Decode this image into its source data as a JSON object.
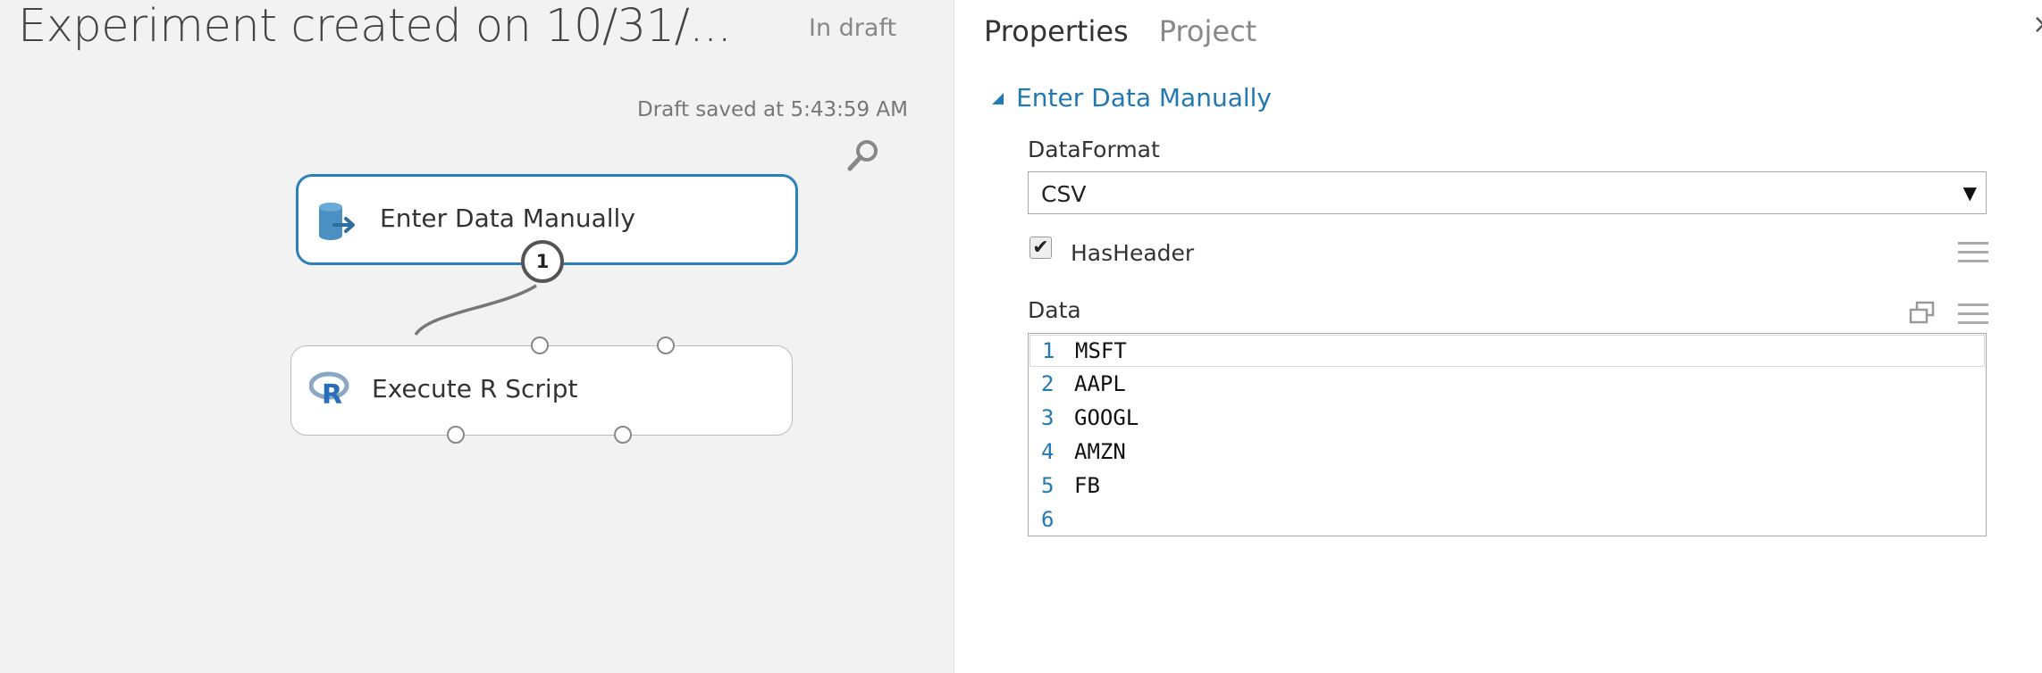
{
  "experiment": {
    "title": "Experiment created on 10/31/...",
    "status": "In draft",
    "draft_saved": "Draft saved at 5:43:59 AM"
  },
  "modules": [
    {
      "label": "Enter Data Manually",
      "icon": "dataset-input-icon",
      "selected": true,
      "output_port_label": "1"
    },
    {
      "label": "Execute R Script",
      "icon": "r-logo-icon",
      "selected": false
    }
  ],
  "panel": {
    "tabs": [
      {
        "label": "Properties",
        "active": true
      },
      {
        "label": "Project",
        "active": false
      }
    ],
    "section_title": "Enter Data Manually",
    "data_format": {
      "label": "DataFormat",
      "value": "CSV"
    },
    "has_header": {
      "label": "HasHeader",
      "checked": true
    },
    "data": {
      "label": "Data",
      "lines": [
        {
          "number": "1",
          "text": "MSFT"
        },
        {
          "number": "2",
          "text": "AAPL"
        },
        {
          "number": "3",
          "text": "GOOGL"
        },
        {
          "number": "4",
          "text": "AMZN"
        },
        {
          "number": "5",
          "text": "FB"
        },
        {
          "number": "6",
          "text": ""
        }
      ]
    }
  },
  "colors": {
    "accent": "#2279b2",
    "selected_border": "#2c7fb8",
    "canvas_bg": "#f2f2f2"
  }
}
